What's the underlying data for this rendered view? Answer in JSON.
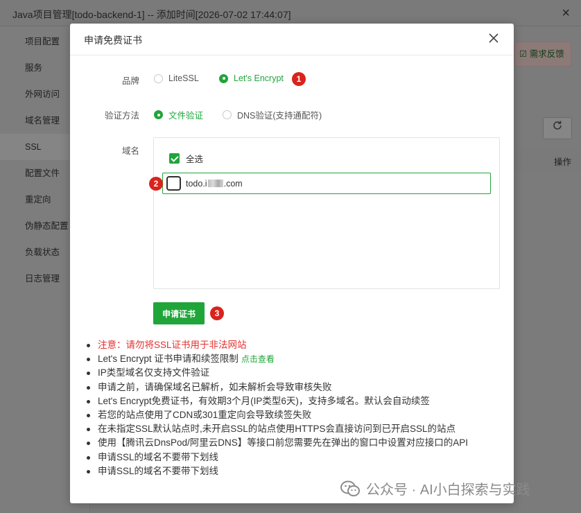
{
  "window": {
    "title": "Java项目管理[todo-backend-1] -- 添加时间[2026-07-02 17:44:07]",
    "close_glyph": "×"
  },
  "sidebar": {
    "items": [
      {
        "label": "项目配置",
        "active": false
      },
      {
        "label": "服务",
        "active": false
      },
      {
        "label": "外网访问",
        "active": false
      },
      {
        "label": "域名管理",
        "active": false
      },
      {
        "label": "SSL",
        "active": true
      },
      {
        "label": "配置文件",
        "active": false
      },
      {
        "label": "重定向",
        "active": false
      },
      {
        "label": "伪静态配置",
        "active": false
      },
      {
        "label": "负载状态",
        "active": false
      },
      {
        "label": "日志管理",
        "active": false
      }
    ]
  },
  "background_main": {
    "feedback_button": "需求反馈",
    "refresh_icon": "refresh-icon",
    "table_column_operation": "操作"
  },
  "modal": {
    "title": "申请免费证书",
    "brand": {
      "label": "品牌",
      "options": [
        {
          "label": "LiteSSL",
          "checked": false
        },
        {
          "label": "Let's Encrypt",
          "checked": true
        }
      ],
      "step_badge": "1"
    },
    "verify": {
      "label": "验证方法",
      "options": [
        {
          "label": "文件验证",
          "checked": true
        },
        {
          "label": "DNS验证(支持通配符)",
          "checked": false
        }
      ]
    },
    "domain": {
      "label": "域名",
      "select_all_label": "全选",
      "select_all_checked": true,
      "items": [
        {
          "prefix": "todo.i",
          "suffix": ".com",
          "checked": true
        }
      ],
      "step_badge": "2"
    },
    "apply_button": "申请证书",
    "apply_step_badge": "3",
    "notes": {
      "warning": "注意：请勿将SSL证书用于非法网站",
      "limit_text": "Let's Encrypt 证书申请和续签限制",
      "limit_link": "点击查看",
      "items": [
        "IP类型域名仅支持文件验证",
        "申请之前，请确保域名已解析，如未解析会导致审核失败",
        "Let's Encrypt免费证书，有效期3个月(IP类型6天)，支持多域名。默认会自动续签",
        "若您的站点使用了CDN或301重定向会导致续签失败",
        "在未指定SSL默认站点时,未开启SSL的站点使用HTTPS会直接访问到已开启SSL的站点",
        "使用【腾讯云DnsPod/阿里云DNS】等接口前您需要先在弹出的窗口中设置对应接口的API",
        "申请SSL的域名不要带下划线",
        "申请SSL的域名不要带下划线"
      ]
    }
  },
  "watermark": {
    "text": "公众号 · AI小白探索与实践"
  },
  "colors": {
    "accent": "#20a53a",
    "badge": "#d9231d",
    "warning": "#e52f2f"
  }
}
